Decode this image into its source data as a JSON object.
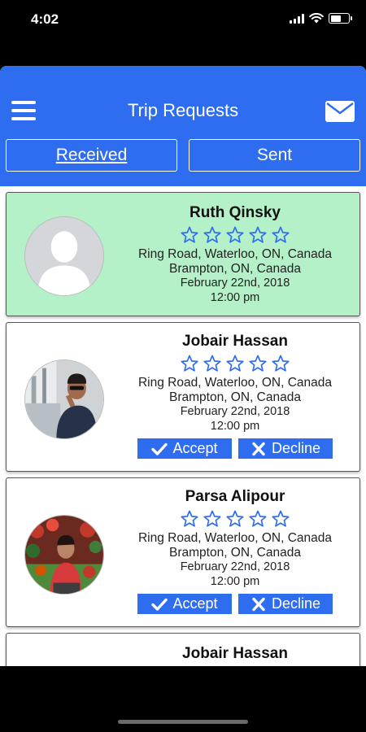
{
  "status_bar": {
    "time": "4:02"
  },
  "header": {
    "title": "Trip Requests",
    "menu_icon": "hamburger-icon",
    "mail_icon": "envelope-icon"
  },
  "tabs": [
    {
      "label": "Received",
      "active": true
    },
    {
      "label": "Sent",
      "active": false
    }
  ],
  "requests": [
    {
      "name": "Ruth Qinsky",
      "from": "Ring Road, Waterloo, ON, Canada",
      "to": "Brampton, ON, Canada",
      "date": "February 22nd, 2018",
      "time": "12:00 pm",
      "rating": 0,
      "accepted": true
    },
    {
      "name": "Jobair Hassan",
      "from": "Ring Road, Waterloo, ON, Canada",
      "to": "Brampton, ON, Canada",
      "date": "February 22nd, 2018",
      "time": "12:00 pm",
      "rating": 0,
      "accepted": false
    },
    {
      "name": "Parsa Alipour",
      "from": "Ring Road, Waterloo, ON, Canada",
      "to": "Brampton, ON, Canada",
      "date": "February 22nd, 2018",
      "time": "12:00 pm",
      "rating": 0,
      "accepted": false
    },
    {
      "name": "Jobair Hassan"
    }
  ],
  "buttons": {
    "accept": "Accept",
    "decline": "Decline"
  },
  "colors": {
    "primary": "#2e6cf0",
    "accepted_bg": "#b4f0c8",
    "star": "#2e6cf0"
  }
}
